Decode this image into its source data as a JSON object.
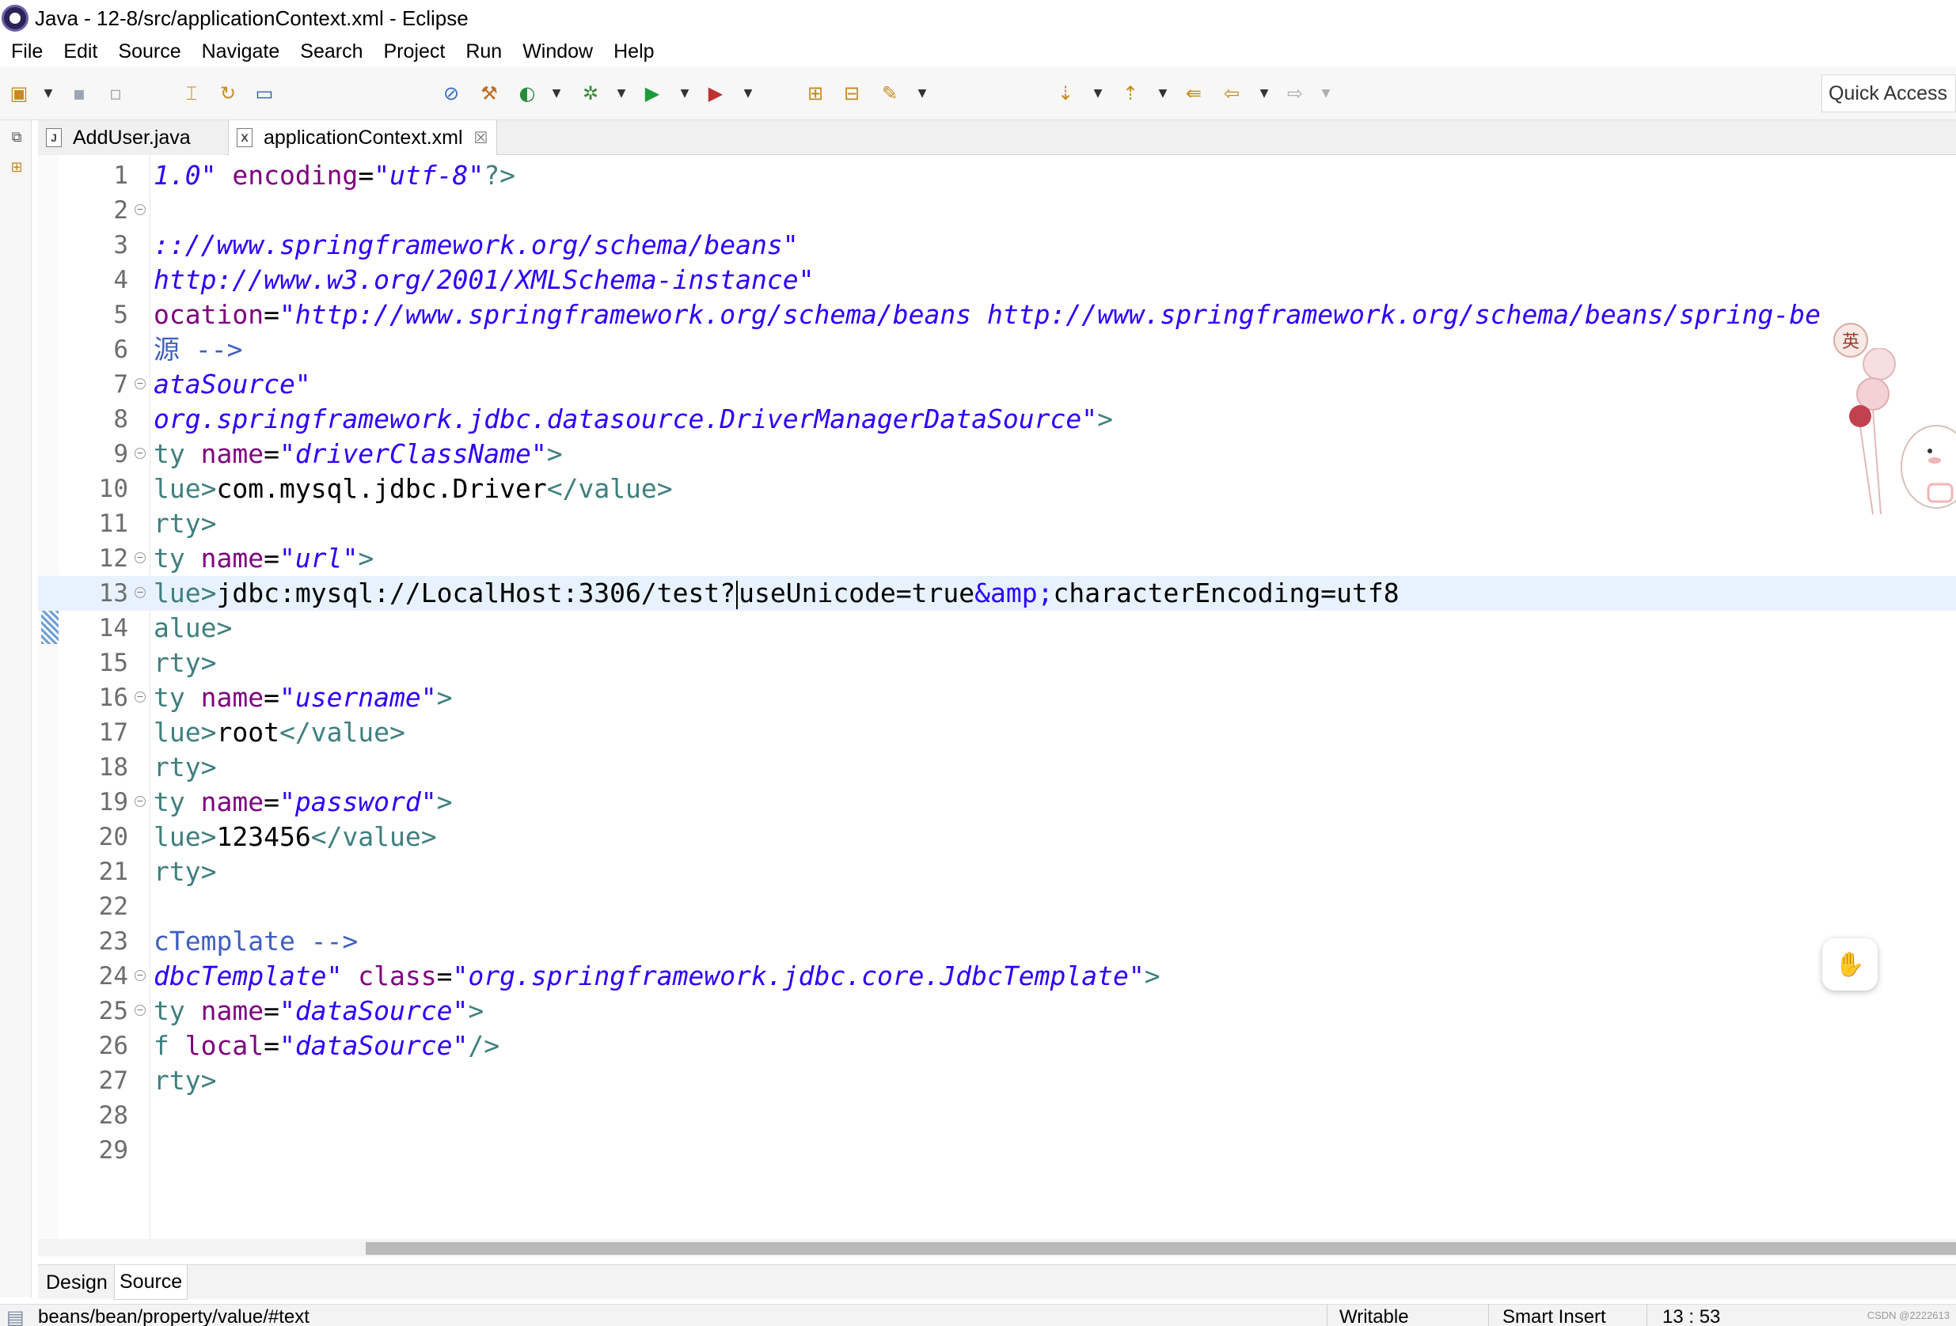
{
  "window": {
    "title": "Java - 12-8/src/applicationContext.xml - Eclipse"
  },
  "menu": [
    "File",
    "Edit",
    "Source",
    "Navigate",
    "Search",
    "Project",
    "Run",
    "Window",
    "Help"
  ],
  "toolbar": {
    "quick_access": "Quick Access"
  },
  "tabs": [
    {
      "label": "AddUser.java",
      "icon": "java-file-icon",
      "icon_glyph": "J"
    },
    {
      "label": "applicationContext.xml",
      "icon": "xml-file-icon",
      "icon_glyph": "X",
      "close": "☒"
    }
  ],
  "editor": {
    "lines": [
      {
        "num": "1",
        "code": [
          [
            "str",
            "1.0\""
          ],
          [
            "txt",
            " "
          ],
          [
            "attr",
            "encoding"
          ],
          [
            "txt",
            "="
          ],
          [
            "str",
            "\"utf-8\""
          ],
          [
            "tag",
            "?>"
          ]
        ]
      },
      {
        "num": "2",
        "fold": true,
        "code": []
      },
      {
        "num": "3",
        "code": [
          [
            "str",
            ":://www.springframework.org/schema/beans\""
          ]
        ]
      },
      {
        "num": "4",
        "code": [
          [
            "str",
            "http://www.w3.org/2001/XMLSchema-instance\""
          ]
        ]
      },
      {
        "num": "5",
        "code": [
          [
            "attr",
            "ocation"
          ],
          [
            "txt",
            "="
          ],
          [
            "str",
            "\"http://www.springframework.org/schema/beans http://www.springframework.org/schema/beans/spring-be"
          ]
        ]
      },
      {
        "num": "6",
        "code": [
          [
            "cmt",
            "源 -->"
          ]
        ]
      },
      {
        "num": "7",
        "fold": true,
        "code": [
          [
            "str",
            "ataSource\""
          ]
        ]
      },
      {
        "num": "8",
        "code": [
          [
            "str",
            "org.springframework.jdbc.datasource.DriverManagerDataSource\""
          ],
          [
            "tag",
            ">"
          ]
        ]
      },
      {
        "num": "9",
        "fold": true,
        "code": [
          [
            "tag",
            "ty "
          ],
          [
            "attr",
            "name"
          ],
          [
            "txt",
            "="
          ],
          [
            "str",
            "\"driverClassName\""
          ],
          [
            "tag",
            ">"
          ]
        ]
      },
      {
        "num": "10",
        "code": [
          [
            "tag",
            "lue>"
          ],
          [
            "txt",
            "com.mysql.jdbc.Driver"
          ],
          [
            "tag",
            "</value>"
          ]
        ]
      },
      {
        "num": "11",
        "code": [
          [
            "tag",
            "rty>"
          ]
        ]
      },
      {
        "num": "12",
        "fold": true,
        "code": [
          [
            "tag",
            "ty "
          ],
          [
            "attr",
            "name"
          ],
          [
            "txt",
            "="
          ],
          [
            "str",
            "\"url\""
          ],
          [
            "tag",
            ">"
          ]
        ]
      },
      {
        "num": "13",
        "fold": true,
        "current": true,
        "code": [
          [
            "tag",
            "lue>"
          ],
          [
            "txt",
            "jdbc:mysql://LocalHost:3306/test?"
          ],
          [
            "caret",
            ""
          ],
          [
            "txt",
            "useUnicode=true"
          ],
          [
            "ent",
            "&amp;"
          ],
          [
            "txt",
            "characterEncoding=utf8"
          ]
        ]
      },
      {
        "num": "14",
        "code": [
          [
            "tag",
            "alue>"
          ]
        ]
      },
      {
        "num": "15",
        "code": [
          [
            "tag",
            "rty>"
          ]
        ]
      },
      {
        "num": "16",
        "fold": true,
        "code": [
          [
            "tag",
            "ty "
          ],
          [
            "attr",
            "name"
          ],
          [
            "txt",
            "="
          ],
          [
            "str",
            "\"username\""
          ],
          [
            "tag",
            ">"
          ]
        ]
      },
      {
        "num": "17",
        "code": [
          [
            "tag",
            "lue>"
          ],
          [
            "txt",
            "root"
          ],
          [
            "tag",
            "</value>"
          ]
        ]
      },
      {
        "num": "18",
        "code": [
          [
            "tag",
            "rty>"
          ]
        ]
      },
      {
        "num": "19",
        "fold": true,
        "code": [
          [
            "tag",
            "ty "
          ],
          [
            "attr",
            "name"
          ],
          [
            "txt",
            "="
          ],
          [
            "str",
            "\"password\""
          ],
          [
            "tag",
            ">"
          ]
        ]
      },
      {
        "num": "20",
        "code": [
          [
            "tag",
            "lue>"
          ],
          [
            "txt",
            "123456"
          ],
          [
            "tag",
            "</value>"
          ]
        ]
      },
      {
        "num": "21",
        "code": [
          [
            "tag",
            "rty>"
          ]
        ]
      },
      {
        "num": "22",
        "code": []
      },
      {
        "num": "23",
        "code": [
          [
            "cmt",
            "cTemplate -->"
          ]
        ]
      },
      {
        "num": "24",
        "fold": true,
        "code": [
          [
            "str",
            "dbcTemplate\""
          ],
          [
            "txt",
            " "
          ],
          [
            "attr",
            "class"
          ],
          [
            "txt",
            "="
          ],
          [
            "str",
            "\"org.springframework.jdbc.core.JdbcTemplate\""
          ],
          [
            "tag",
            ">"
          ]
        ]
      },
      {
        "num": "25",
        "fold": true,
        "code": [
          [
            "tag",
            "ty "
          ],
          [
            "attr",
            "name"
          ],
          [
            "txt",
            "="
          ],
          [
            "str",
            "\"dataSource\""
          ],
          [
            "tag",
            ">"
          ]
        ]
      },
      {
        "num": "26",
        "code": [
          [
            "tag",
            "f "
          ],
          [
            "attr",
            "local"
          ],
          [
            "txt",
            "="
          ],
          [
            "str",
            "\"dataSource\""
          ],
          [
            "tag",
            "/>"
          ]
        ]
      },
      {
        "num": "27",
        "code": [
          [
            "tag",
            "rty>"
          ]
        ]
      },
      {
        "num": "28",
        "code": []
      },
      {
        "num": "29",
        "code": []
      }
    ]
  },
  "mode_tabs": {
    "design": "Design",
    "source": "Source"
  },
  "status": {
    "path": "beans/bean/property/value/#text",
    "writable": "Writable",
    "insert_mode": "Smart Insert",
    "position": "13 : 53",
    "watermark": "CSDN @2222613"
  },
  "widgets": {
    "ime_indicator": "英"
  },
  "colors": {
    "tag": "#3f7f7f",
    "attribute": "#7f007f",
    "string": "#2a00ff",
    "comment": "#3f5fbf",
    "current_line": "#e8f2fe"
  }
}
